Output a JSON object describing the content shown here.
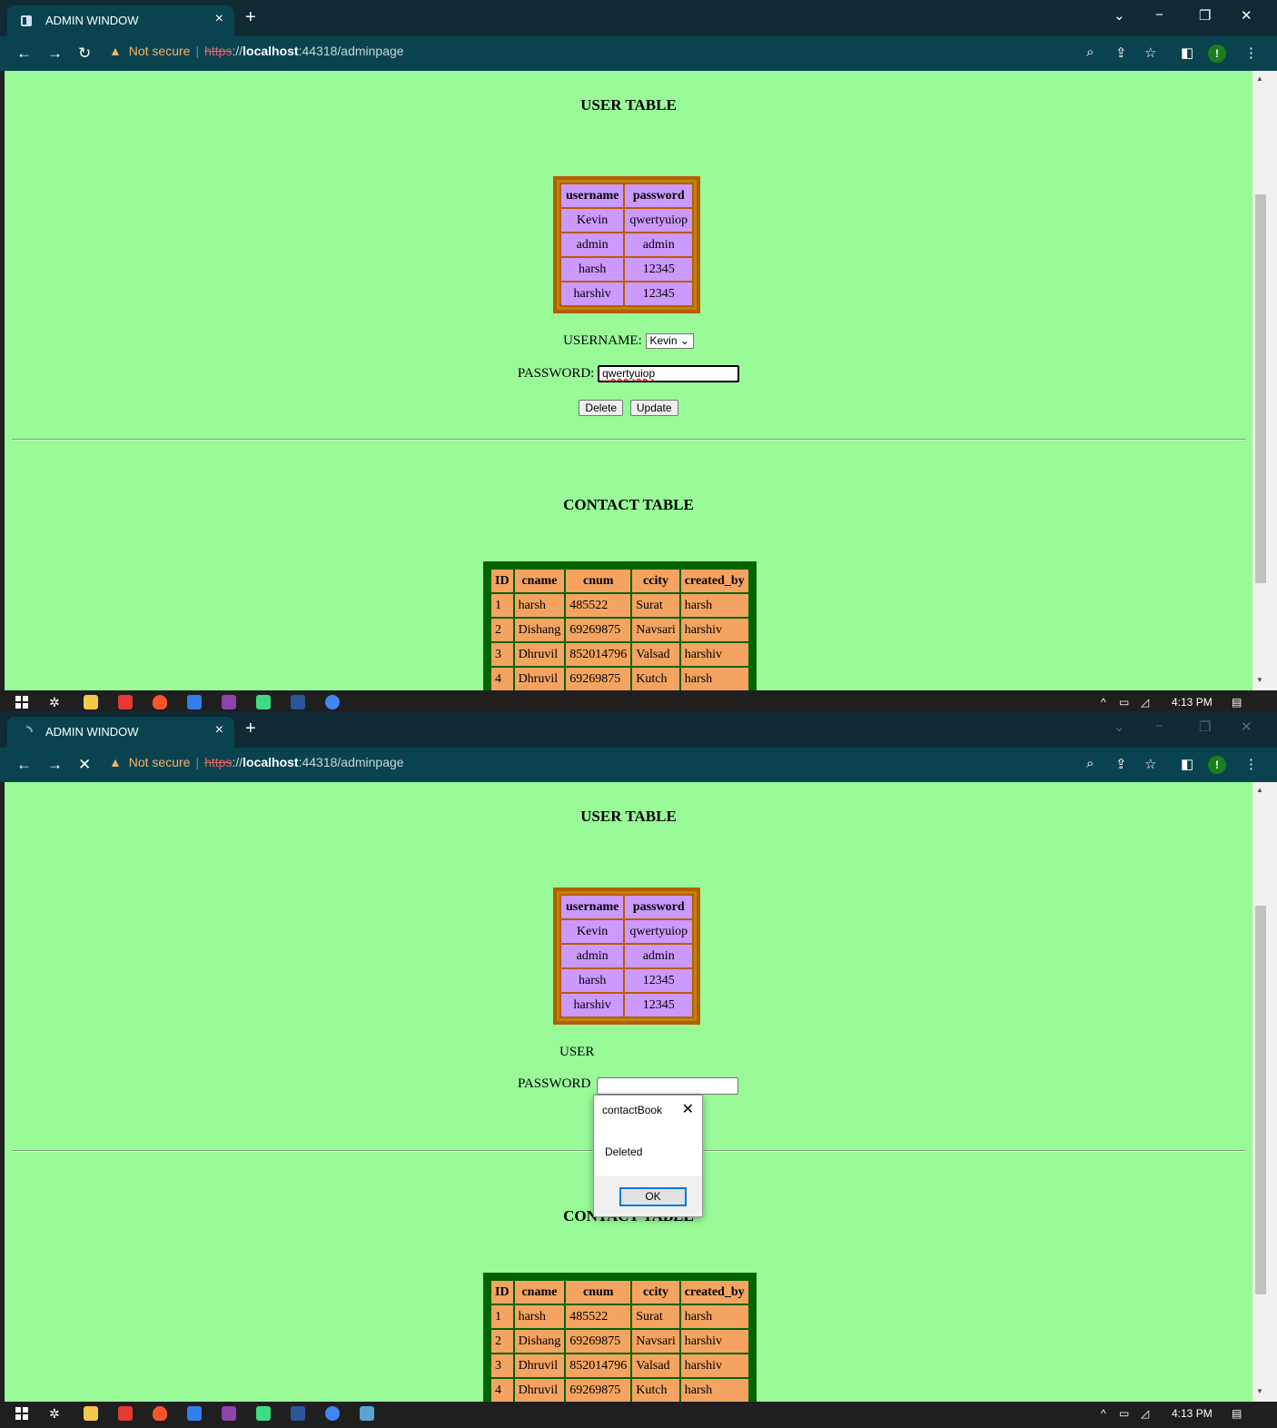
{
  "shots": [
    {
      "tab_title": "ADMIN WINDOW",
      "reload_icon": "reload-icon",
      "url": {
        "warning": "Not secure",
        "scheme": "https",
        "rest": "://",
        "host": "localhost",
        "path": ":44318/adminpage"
      },
      "user_section_title": "USER TABLE",
      "user_table": {
        "headers": [
          "username",
          "password"
        ],
        "rows": [
          [
            "Kevin",
            "qwertyuiop"
          ],
          [
            "admin",
            "admin"
          ],
          [
            "harsh",
            "12345"
          ],
          [
            "harshiv",
            "12345"
          ]
        ]
      },
      "form": {
        "username_label": "USERNAME:",
        "username_value": "Kevin",
        "password_label": "PASSWORD:",
        "password_value": "qwertyuiop",
        "delete_label": "Delete",
        "update_label": "Update"
      },
      "contact_section_title": "CONTACT TABLE",
      "contact_table": {
        "headers": [
          "ID",
          "cname",
          "cnum",
          "ccity",
          "created_by"
        ],
        "rows": [
          [
            "1",
            "harsh",
            "485522",
            "Surat",
            "harsh"
          ],
          [
            "2",
            "Dishang",
            "69269875",
            "Navsari",
            "harshiv"
          ],
          [
            "3",
            "Dhruvil",
            "852014796",
            "Valsad",
            "harshiv"
          ],
          [
            "4",
            "Dhruvil",
            "69269875",
            "Kutch",
            "harsh"
          ]
        ]
      },
      "clock": "4:13 PM"
    },
    {
      "tab_title": "ADMIN WINDOW",
      "reload_icon": "stop-loading-icon",
      "url": {
        "warning": "Not secure",
        "scheme": "https",
        "rest": "://",
        "host": "localhost",
        "path": ":44318/adminpage"
      },
      "user_section_title": "USER TABLE",
      "user_table": {
        "headers": [
          "username",
          "password"
        ],
        "rows": [
          [
            "Kevin",
            "qwertyuiop"
          ],
          [
            "admin",
            "admin"
          ],
          [
            "harsh",
            "12345"
          ],
          [
            "harshiv",
            "12345"
          ]
        ]
      },
      "form": {
        "username_label": "USER",
        "password_label": "PASSWORD"
      },
      "dialog": {
        "title": "contactBook",
        "message": "Deleted",
        "ok_label": "OK"
      },
      "contact_section_title": "CONTACT TABLE",
      "contact_table": {
        "headers": [
          "ID",
          "cname",
          "cnum",
          "ccity",
          "created_by"
        ],
        "rows": [
          [
            "1",
            "harsh",
            "485522",
            "Surat",
            "harsh"
          ],
          [
            "2",
            "Dishang",
            "69269875",
            "Navsari",
            "harshiv"
          ],
          [
            "3",
            "Dhruvil",
            "852014796",
            "Valsad",
            "harshiv"
          ],
          [
            "4",
            "Dhruvil",
            "69269875",
            "Kutch",
            "harsh"
          ]
        ]
      },
      "clock": "4:13 PM"
    }
  ],
  "colors": {
    "page_bg": "#98fb98",
    "user_table_bg": "#cc99ff",
    "user_table_border": "#b85c00",
    "contact_table_bg": "#f4a460",
    "contact_table_border": "#006400",
    "browser_frame": "#0a4350"
  }
}
